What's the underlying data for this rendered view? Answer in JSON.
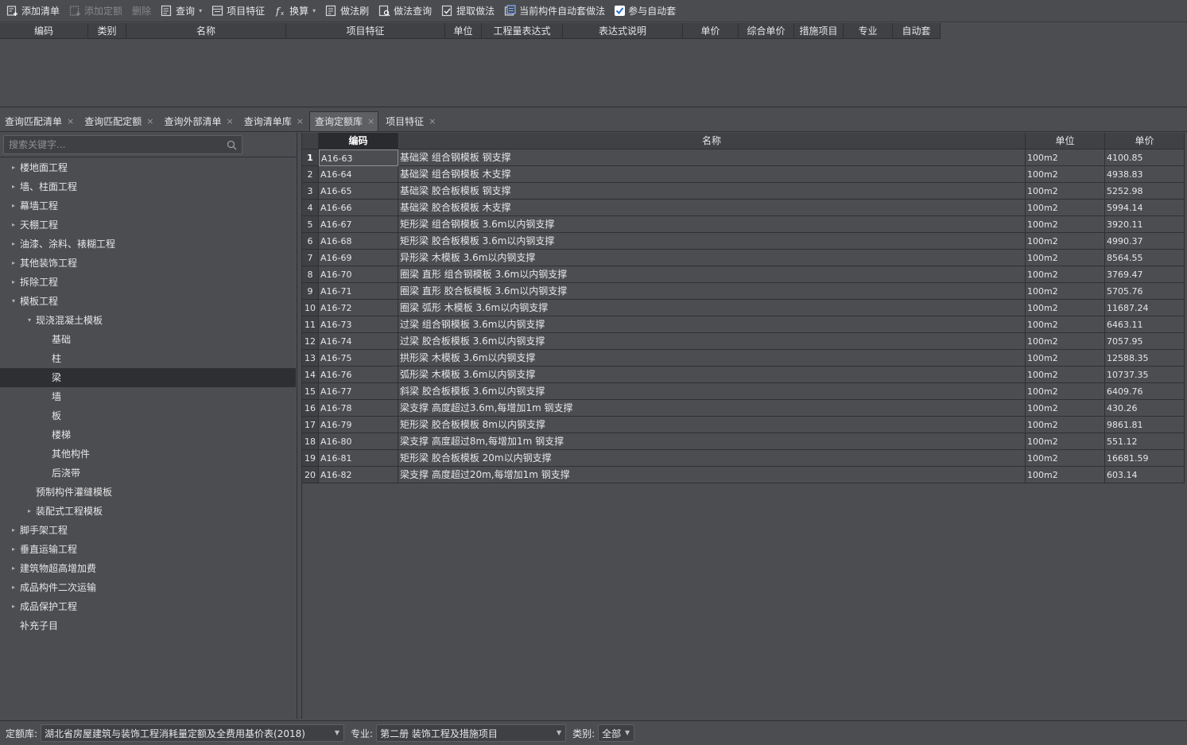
{
  "toolbar": {
    "items": [
      {
        "label": "添加清单",
        "icon": "add-list-icon",
        "disabled": false,
        "caret": false
      },
      {
        "label": "添加定额",
        "icon": "add-quota-icon",
        "disabled": true,
        "caret": false
      },
      {
        "label": "删除",
        "icon": "",
        "disabled": true,
        "caret": false
      },
      {
        "label": "查询",
        "icon": "query-icon",
        "disabled": false,
        "caret": true
      },
      {
        "label": "项目特征",
        "icon": "project-feature-icon",
        "disabled": false,
        "caret": false
      },
      {
        "label": "换算",
        "icon": "function-icon",
        "disabled": false,
        "caret": true
      },
      {
        "label": "做法刷",
        "icon": "method-brush-icon",
        "disabled": false,
        "caret": false
      },
      {
        "label": "做法查询",
        "icon": "method-query-icon",
        "disabled": false,
        "caret": false
      },
      {
        "label": "提取做法",
        "icon": "extract-method-icon",
        "disabled": false,
        "caret": false
      },
      {
        "label": "当前构件自动套做法",
        "icon": "auto-apply-icon",
        "disabled": false,
        "caret": false
      }
    ],
    "auto_check": {
      "label": "参与自动套",
      "checked": true
    }
  },
  "top_table": {
    "columns": [
      "编码",
      "类别",
      "名称",
      "项目特征",
      "单位",
      "工程量表达式",
      "表达式说明",
      "单价",
      "综合单价",
      "措施项目",
      "专业",
      "自动套"
    ]
  },
  "tabs": [
    {
      "label": "查询匹配清单",
      "active": false
    },
    {
      "label": "查询匹配定额",
      "active": false
    },
    {
      "label": "查询外部清单",
      "active": false
    },
    {
      "label": "查询清单库",
      "active": false
    },
    {
      "label": "查询定额库",
      "active": true
    },
    {
      "label": "项目特征",
      "active": false
    }
  ],
  "search": {
    "placeholder": "搜索关键字..."
  },
  "tree": [
    {
      "label": "楼地面工程",
      "level": 0,
      "arrow": "collapsed",
      "selected": false
    },
    {
      "label": "墙、柱面工程",
      "level": 0,
      "arrow": "collapsed",
      "selected": false
    },
    {
      "label": "幕墙工程",
      "level": 0,
      "arrow": "collapsed",
      "selected": false
    },
    {
      "label": "天棚工程",
      "level": 0,
      "arrow": "collapsed",
      "selected": false
    },
    {
      "label": "油漆、涂料、裱糊工程",
      "level": 0,
      "arrow": "collapsed",
      "selected": false
    },
    {
      "label": "其他装饰工程",
      "level": 0,
      "arrow": "collapsed",
      "selected": false
    },
    {
      "label": "拆除工程",
      "level": 0,
      "arrow": "collapsed",
      "selected": false
    },
    {
      "label": "模板工程",
      "level": 0,
      "arrow": "expanded",
      "selected": false
    },
    {
      "label": "现浇混凝土模板",
      "level": 1,
      "arrow": "expanded",
      "selected": false
    },
    {
      "label": "基础",
      "level": 2,
      "arrow": "none",
      "selected": false
    },
    {
      "label": "柱",
      "level": 2,
      "arrow": "none",
      "selected": false
    },
    {
      "label": "梁",
      "level": 2,
      "arrow": "none",
      "selected": true
    },
    {
      "label": "墙",
      "level": 2,
      "arrow": "none",
      "selected": false
    },
    {
      "label": "板",
      "level": 2,
      "arrow": "none",
      "selected": false
    },
    {
      "label": "楼梯",
      "level": 2,
      "arrow": "none",
      "selected": false
    },
    {
      "label": "其他构件",
      "level": 2,
      "arrow": "none",
      "selected": false
    },
    {
      "label": "后浇带",
      "level": 2,
      "arrow": "none",
      "selected": false
    },
    {
      "label": "预制构件灌缝模板",
      "level": 1,
      "arrow": "none",
      "selected": false
    },
    {
      "label": "装配式工程模板",
      "level": 1,
      "arrow": "collapsed",
      "selected": false
    },
    {
      "label": "脚手架工程",
      "level": 0,
      "arrow": "collapsed",
      "selected": false
    },
    {
      "label": "垂直运输工程",
      "level": 0,
      "arrow": "collapsed",
      "selected": false
    },
    {
      "label": "建筑物超高增加费",
      "level": 0,
      "arrow": "collapsed",
      "selected": false
    },
    {
      "label": "成品构件二次运输",
      "level": 0,
      "arrow": "collapsed",
      "selected": false
    },
    {
      "label": "成品保护工程",
      "level": 0,
      "arrow": "collapsed",
      "selected": false
    },
    {
      "label": "补充子目",
      "level": 0,
      "arrow": "none",
      "selected": false
    }
  ],
  "grid": {
    "columns": [
      "",
      "编码",
      "名称",
      "单位",
      "单价"
    ],
    "rows": [
      {
        "num": "1",
        "code": "A16-63",
        "name": "基础梁 组合钢模板 钢支撑",
        "unit": "100m2",
        "price": "4100.85"
      },
      {
        "num": "2",
        "code": "A16-64",
        "name": "基础梁 组合钢模板 木支撑",
        "unit": "100m2",
        "price": "4938.83"
      },
      {
        "num": "3",
        "code": "A16-65",
        "name": "基础梁 胶合板模板 钢支撑",
        "unit": "100m2",
        "price": "5252.98"
      },
      {
        "num": "4",
        "code": "A16-66",
        "name": "基础梁 胶合板模板 木支撑",
        "unit": "100m2",
        "price": "5994.14"
      },
      {
        "num": "5",
        "code": "A16-67",
        "name": "矩形梁 组合钢模板 3.6m以内钢支撑",
        "unit": "100m2",
        "price": "3920.11"
      },
      {
        "num": "6",
        "code": "A16-68",
        "name": "矩形梁 胶合板模板 3.6m以内钢支撑",
        "unit": "100m2",
        "price": "4990.37"
      },
      {
        "num": "7",
        "code": "A16-69",
        "name": "异形梁 木模板 3.6m以内钢支撑",
        "unit": "100m2",
        "price": "8564.55"
      },
      {
        "num": "8",
        "code": "A16-70",
        "name": "圈梁 直形 组合钢模板 3.6m以内钢支撑",
        "unit": "100m2",
        "price": "3769.47"
      },
      {
        "num": "9",
        "code": "A16-71",
        "name": "圈梁 直形 胶合板模板 3.6m以内钢支撑",
        "unit": "100m2",
        "price": "5705.76"
      },
      {
        "num": "10",
        "code": "A16-72",
        "name": "圈梁 弧形 木模板 3.6m以内钢支撑",
        "unit": "100m2",
        "price": "11687.24"
      },
      {
        "num": "11",
        "code": "A16-73",
        "name": "过梁 组合钢模板 3.6m以内钢支撑",
        "unit": "100m2",
        "price": "6463.11"
      },
      {
        "num": "12",
        "code": "A16-74",
        "name": "过梁 胶合板模板 3.6m以内钢支撑",
        "unit": "100m2",
        "price": "7057.95"
      },
      {
        "num": "13",
        "code": "A16-75",
        "name": "拱形梁 木模板 3.6m以内钢支撑",
        "unit": "100m2",
        "price": "12588.35"
      },
      {
        "num": "14",
        "code": "A16-76",
        "name": "弧形梁 木模板 3.6m以内钢支撑",
        "unit": "100m2",
        "price": "10737.35"
      },
      {
        "num": "15",
        "code": "A16-77",
        "name": "斜梁 胶合板模板 3.6m以内钢支撑",
        "unit": "100m2",
        "price": "6409.76"
      },
      {
        "num": "16",
        "code": "A16-78",
        "name": "梁支撑 高度超过3.6m,每增加1m 钢支撑",
        "unit": "100m2",
        "price": "430.26"
      },
      {
        "num": "17",
        "code": "A16-79",
        "name": "矩形梁 胶合板模板 8m以内钢支撑",
        "unit": "100m2",
        "price": "9861.81"
      },
      {
        "num": "18",
        "code": "A16-80",
        "name": "梁支撑 高度超过8m,每增加1m 钢支撑",
        "unit": "100m2",
        "price": "551.12"
      },
      {
        "num": "19",
        "code": "A16-81",
        "name": "矩形梁 胶合板模板 20m以内钢支撑",
        "unit": "100m2",
        "price": "16681.59"
      },
      {
        "num": "20",
        "code": "A16-82",
        "name": "梁支撑 高度超过20m,每增加1m 钢支撑",
        "unit": "100m2",
        "price": "603.14"
      }
    ]
  },
  "statusbar": {
    "quota_label": "定额库:",
    "quota_value": "湖北省房屋建筑与装饰工程消耗量定额及全费用基价表(2018)",
    "major_label": "专业:",
    "major_value": "第二册 装饰工程及措施项目",
    "type_label": "类别:",
    "type_value": "全部"
  },
  "colors": {
    "background": "#4b4d51",
    "header": "#3f4145",
    "selected": "#2e2f32",
    "grid_line": "#2f3033"
  }
}
